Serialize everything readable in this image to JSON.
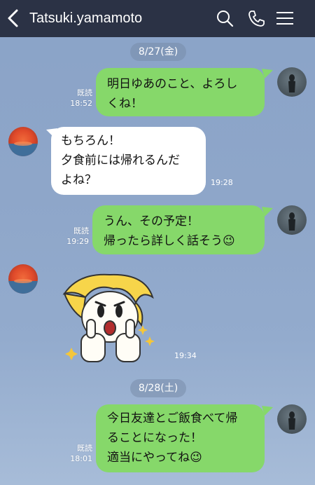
{
  "header": {
    "title": "Tatsuki.yamamoto"
  },
  "dates": [
    "8/27(金)",
    "8/28(土)"
  ],
  "messages": [
    {
      "line1": "明日ゆあのこと、よろし",
      "line2": "くね！",
      "read": "既読",
      "time": "18:52"
    },
    {
      "line1": "もちろん！",
      "line2": "夕食前には帰れるんだ",
      "line3": "よね？",
      "time": "19:28"
    },
    {
      "line1": "うん、その予定！",
      "line2": "帰ったら詳しく話そう",
      "emoji": "😉",
      "read": "既読",
      "time": "19:29"
    },
    {
      "time": "19:34"
    },
    {
      "line1": "今日友達とご飯食べて帰",
      "line2": "ることになった！",
      "line3": "適当にやってね",
      "emoji": "😉",
      "read": "既読",
      "time": "18:01"
    }
  ],
  "icons": [
    "back-arrow-icon",
    "search-icon",
    "phone-icon",
    "menu-icon"
  ],
  "colors": {
    "header": "#2b3245",
    "sent_bubble": "#86d86a",
    "received_bubble": "#ffffff"
  }
}
